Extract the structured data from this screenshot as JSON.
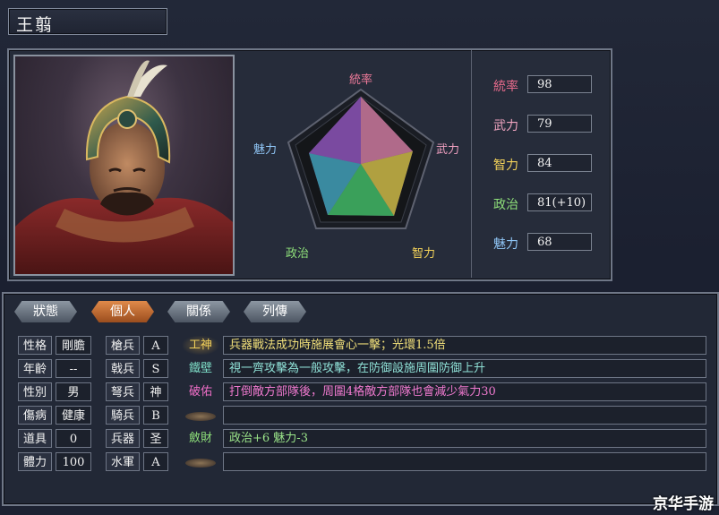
{
  "general": {
    "name": "王翦"
  },
  "radar": {
    "labels": {
      "tong": "統率",
      "wu": "武力",
      "zhi": "智力",
      "zheng": "政治",
      "mei": "魅力"
    }
  },
  "stats": [
    {
      "label": "統率",
      "value": "98",
      "color": "#e86b8c"
    },
    {
      "label": "武力",
      "value": "79",
      "color": "#f0a4c0"
    },
    {
      "label": "智力",
      "value": "84",
      "color": "#f4d35a"
    },
    {
      "label": "政治",
      "value": "81(+10)",
      "color": "#8ee07a"
    },
    {
      "label": "魅力",
      "value": "68",
      "color": "#8fc5f5"
    }
  ],
  "tabs": [
    "狀態",
    "個人",
    "關係",
    "列傳"
  ],
  "active_tab": "個人",
  "attributes": [
    {
      "key": "性格",
      "value": "剛膽"
    },
    {
      "key": "年齡",
      "value": "--"
    },
    {
      "key": "性別",
      "value": "男"
    },
    {
      "key": "傷病",
      "value": "健康"
    },
    {
      "key": "道具",
      "value": "0"
    },
    {
      "key": "體力",
      "value": "100"
    }
  ],
  "troops": [
    {
      "key": "槍兵",
      "grade": "A"
    },
    {
      "key": "戟兵",
      "grade": "S"
    },
    {
      "key": "弩兵",
      "grade": "神"
    },
    {
      "key": "騎兵",
      "grade": "B"
    },
    {
      "key": "兵器",
      "grade": "圣"
    },
    {
      "key": "水軍",
      "grade": "A"
    }
  ],
  "skills": [
    {
      "name": "工神",
      "name_color": "#f2d05a",
      "desc": "兵器戰法成功時施展會心一擊；光環1.5倍",
      "desc_color": "#f2e07a"
    },
    {
      "name": "鐵壁",
      "name_color": "#7fe0c9",
      "desc": "視一齊攻擊為一般攻擊，在防御設施周圍防御上升",
      "desc_color": "#8fe0d6"
    },
    {
      "name": "破佑",
      "name_color": "#f06ec8",
      "desc": "打倒敵方部隊後，周圍4格敵方部隊也會減少氣力30",
      "desc_color": "#f07ad0"
    },
    {
      "name": "",
      "desc": ""
    },
    {
      "name": "斂財",
      "name_color": "#8ee07a",
      "desc": "政治+6 魅力-3",
      "desc_color": "#9be58a"
    },
    {
      "name": "",
      "desc": ""
    }
  ],
  "watermark": "京华手游"
}
